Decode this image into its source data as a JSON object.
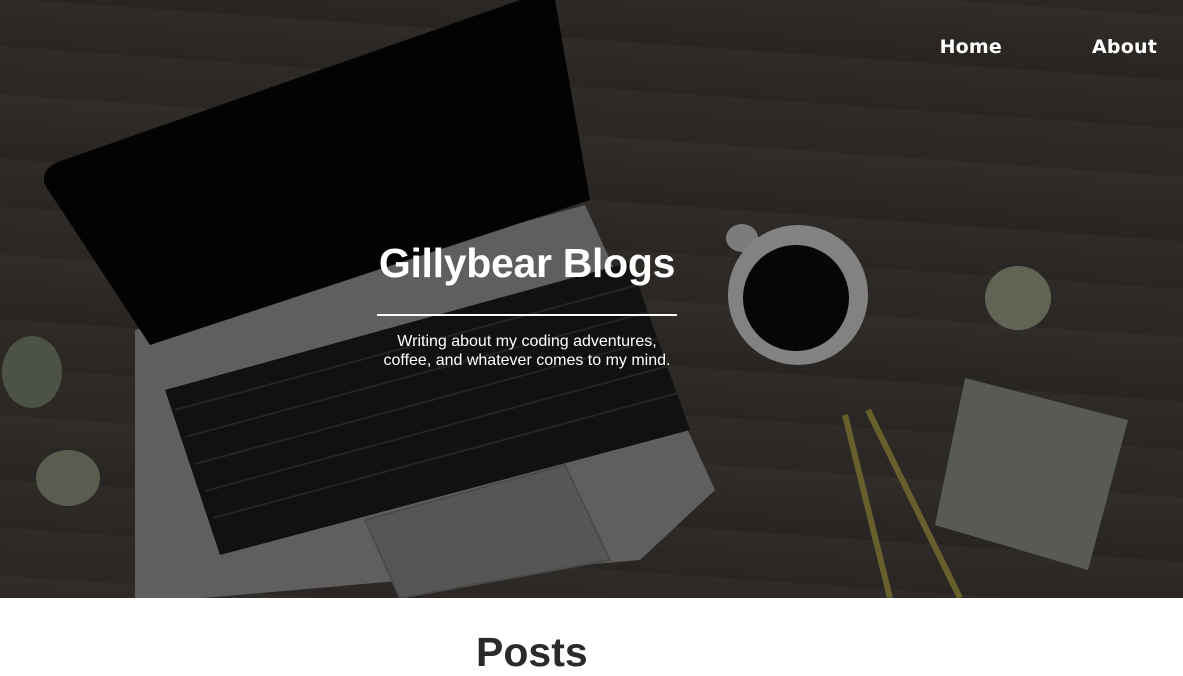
{
  "nav": {
    "items": [
      {
        "label": "Home"
      },
      {
        "label": "About"
      }
    ]
  },
  "hero": {
    "title": "Gillybear Blogs",
    "subtitle_line1": "Writing about my coding adventures,",
    "subtitle_line2": "coffee, and whatever comes to my mind."
  },
  "main": {
    "posts_heading": "Posts"
  }
}
